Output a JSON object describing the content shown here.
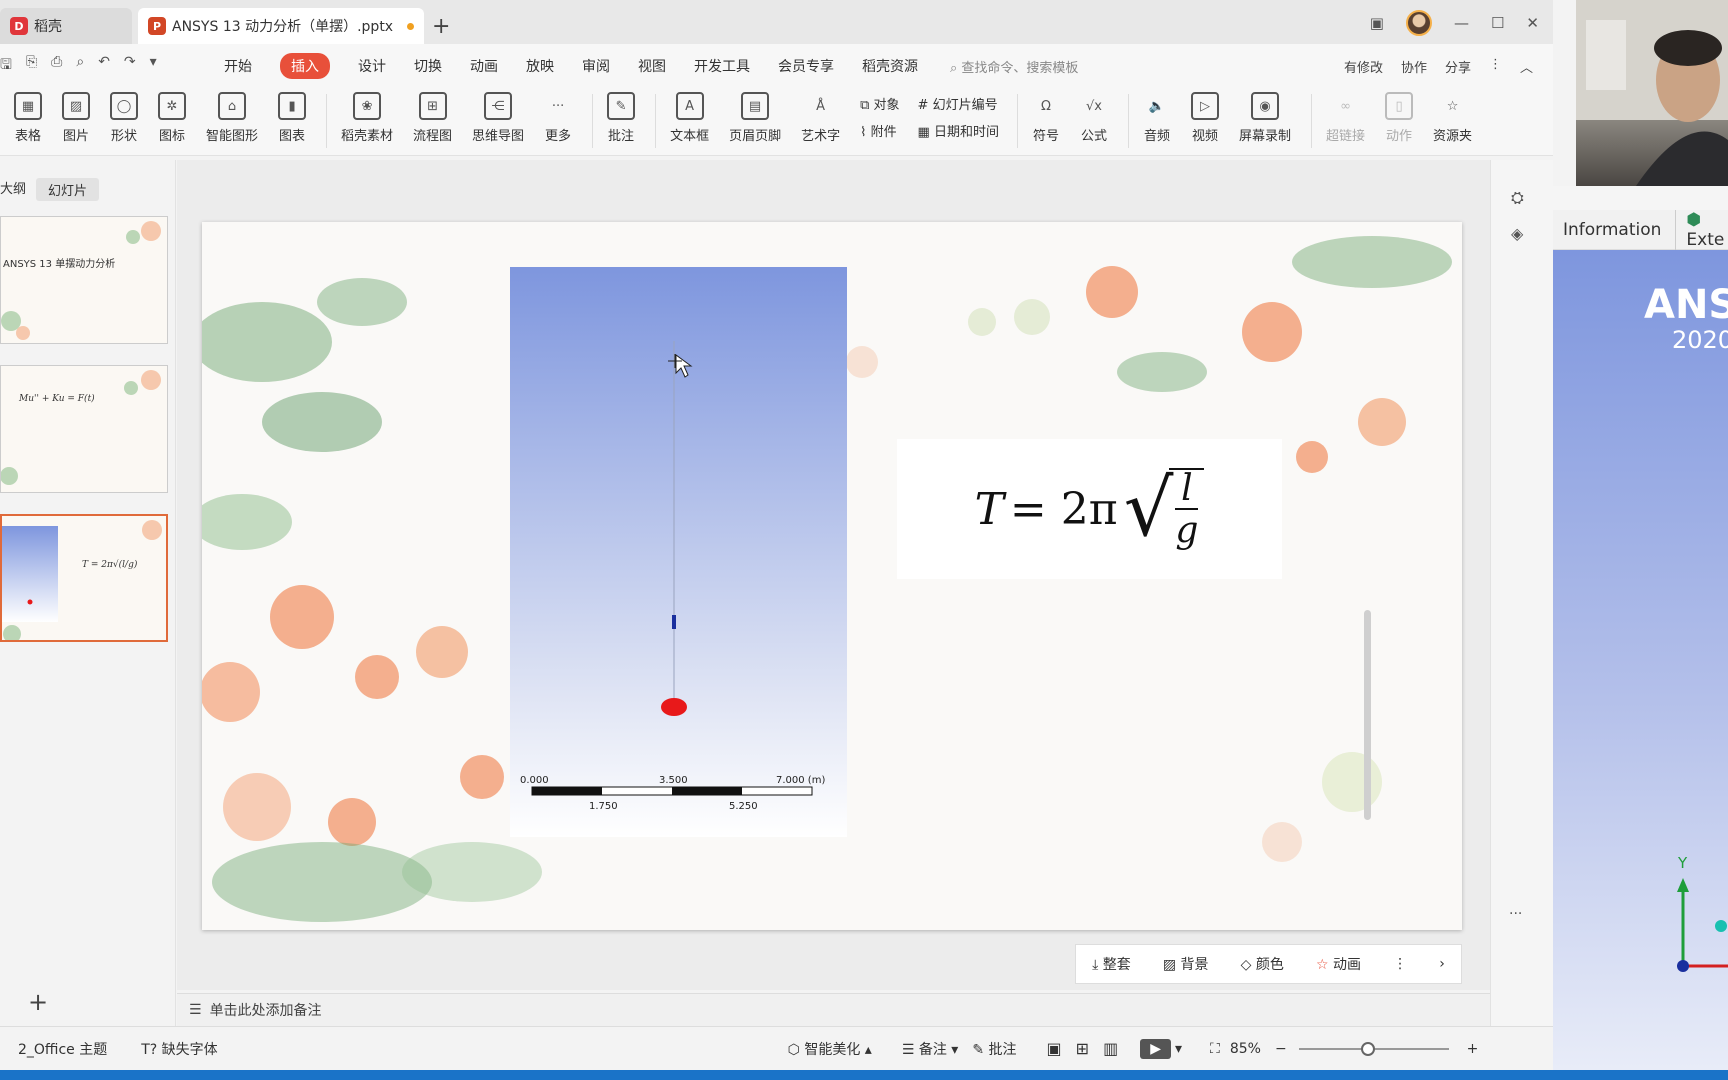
{
  "tabs": {
    "home": "稻壳",
    "document": "ANSYS 13 动力分析（单摆）.pptx"
  },
  "menu": {
    "items": [
      "开始",
      "插入",
      "设计",
      "切换",
      "动画",
      "放映",
      "审阅",
      "视图",
      "开发工具",
      "会员专享",
      "稻壳资源"
    ],
    "active": "插入",
    "search_placeholder": "查找命令、搜索模板",
    "right": [
      "有修改",
      "协作",
      "分享"
    ]
  },
  "ribbon": {
    "big": [
      "表格",
      "图片",
      "形状",
      "图标",
      "智能图形",
      "图表",
      "稻壳素材",
      "流程图",
      "思维导图",
      "更多",
      "批注",
      "文本框",
      "页眉页脚",
      "艺术字"
    ],
    "pair1": [
      "对象",
      "附件"
    ],
    "pair2": [
      "幻灯片编号",
      "日期和时间"
    ],
    "big2": [
      "符号",
      "公式",
      "音频",
      "视频",
      "屏幕录制",
      "超链接",
      "动作",
      "资源夹"
    ]
  },
  "left_panel": {
    "tab_outline": "大纲",
    "tab_slides": "幻灯片",
    "slide1_title": "ANSYS 13 单摆动力分析",
    "slide2_formula": "Mu'' + Ku = F(t)",
    "slide3_formula": "T = 2π√(l/g)"
  },
  "slide": {
    "formula_T": "T",
    "formula_eq": "= 2π",
    "formula_num": "l",
    "formula_den": "g",
    "scale_labels": [
      "0.000",
      "3.500",
      "7.000 (m)"
    ],
    "scale_sublabels": [
      "1.750",
      "5.250"
    ]
  },
  "slide_tools": [
    "整套",
    "背景",
    "颜色",
    "动画"
  ],
  "notes_placeholder": "单击此处添加备注",
  "status": {
    "theme": "2_Office 主题",
    "missing_font": "缺失字体",
    "beautify": "智能美化",
    "notes": "备注",
    "comments": "批注",
    "zoom": "85%"
  },
  "right_panel": {
    "tab_info": "Information",
    "tab_ext": "Exte",
    "logo": "ANSYS",
    "year": "2020",
    "axis_label": "Y"
  },
  "colors": {
    "accent": "#e8503a",
    "ansys_bg_top": "#7e96de",
    "pendulum_ball": "#e8191a"
  }
}
